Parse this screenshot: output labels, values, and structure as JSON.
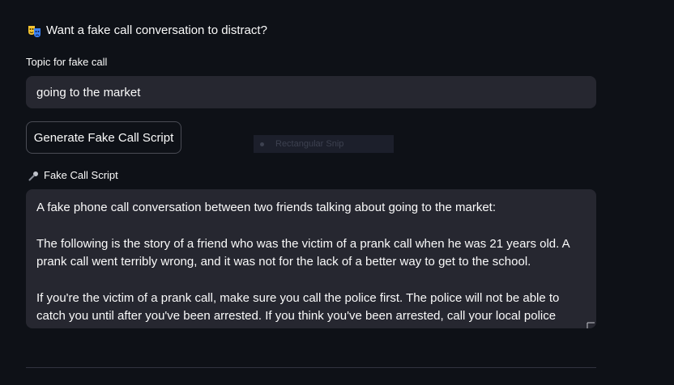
{
  "header": {
    "icon": "performing-arts-icon",
    "title": "Want a fake call conversation to distract?"
  },
  "topic": {
    "label": "Topic for fake call",
    "value": "going to the market"
  },
  "generate_button": {
    "label": "Generate Fake Call Script"
  },
  "snip_overlay": {
    "label": "Rectangular Snip"
  },
  "script": {
    "icon": "microphone-icon",
    "label": "Fake Call Script",
    "paragraphs": [
      "A fake phone call conversation between two friends talking about going to the market:",
      "The following is the story of a friend who was the victim of a prank call when he was 21 years old. A prank call went terribly wrong, and it was not for the lack of a better way to get to the school.",
      "If you're the victim of a prank call, make sure you call the police first. The police will not be able to catch you until after you've been arrested. If you think you've been arrested, call your local police"
    ]
  },
  "colors": {
    "background": "#0e1117",
    "input_background": "#262730",
    "text": "#fafafa",
    "button_border": "#4a4c55"
  }
}
